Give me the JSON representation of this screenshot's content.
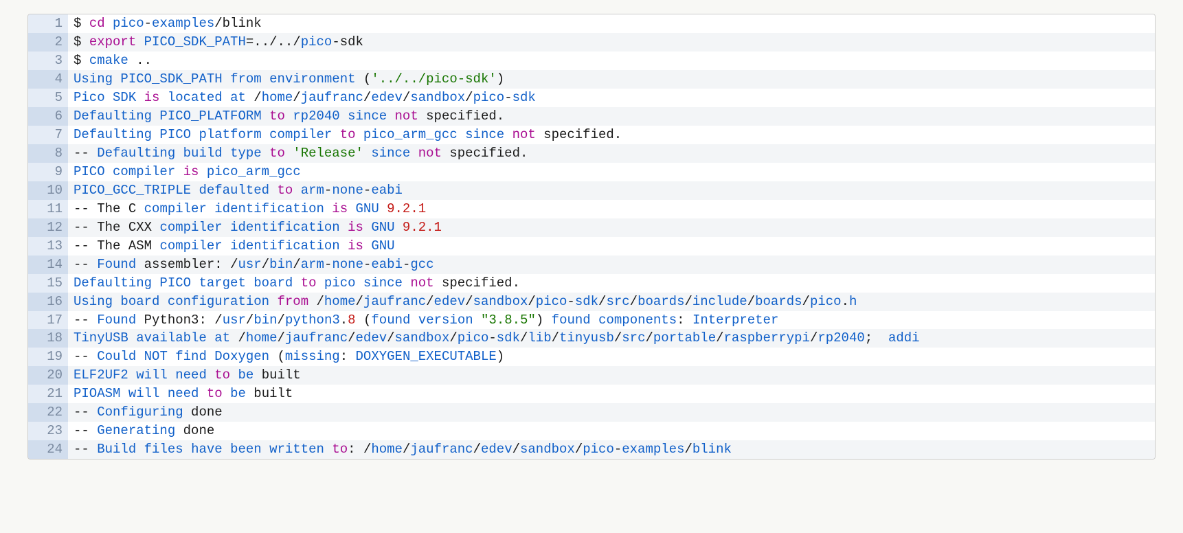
{
  "lines": [
    {
      "n": 1,
      "tokens": [
        [
          "$ ",
          "t-black"
        ],
        [
          "cd ",
          "t-purple"
        ],
        [
          "pico",
          "t-blue"
        ],
        [
          "-",
          "t-black"
        ],
        [
          "examples",
          "t-blue"
        ],
        [
          "/",
          "t-black"
        ],
        [
          "blink",
          "t-black"
        ]
      ]
    },
    {
      "n": 2,
      "tokens": [
        [
          "$ ",
          "t-black"
        ],
        [
          "export ",
          "t-purple"
        ],
        [
          "PICO_SDK_PATH",
          "t-blue"
        ],
        [
          "=",
          "t-black"
        ],
        [
          ".",
          "t-black"
        ],
        [
          ".",
          "t-black"
        ],
        [
          "/",
          "t-black"
        ],
        [
          ".",
          "t-black"
        ],
        [
          ".",
          "t-black"
        ],
        [
          "/",
          "t-black"
        ],
        [
          "pico",
          "t-blue"
        ],
        [
          "-",
          "t-black"
        ],
        [
          "sdk",
          "t-black"
        ]
      ]
    },
    {
      "n": 3,
      "tokens": [
        [
          "$ ",
          "t-black"
        ],
        [
          "cmake ",
          "t-blue"
        ],
        [
          "..",
          "t-black"
        ]
      ]
    },
    {
      "n": 4,
      "tokens": [
        [
          "Using ",
          "t-blue"
        ],
        [
          "PICO_SDK_PATH ",
          "t-blue"
        ],
        [
          "from ",
          "t-blue"
        ],
        [
          "environment ",
          "t-blue"
        ],
        [
          "(",
          "t-black"
        ],
        [
          "'../../pico-sdk'",
          "t-green"
        ],
        [
          ")",
          "t-black"
        ]
      ]
    },
    {
      "n": 5,
      "tokens": [
        [
          "Pico ",
          "t-blue"
        ],
        [
          "SDK ",
          "t-blue"
        ],
        [
          "is ",
          "t-purple"
        ],
        [
          "located ",
          "t-blue"
        ],
        [
          "at ",
          "t-blue"
        ],
        [
          "/",
          "t-black"
        ],
        [
          "home",
          "t-blue"
        ],
        [
          "/",
          "t-black"
        ],
        [
          "jaufranc",
          "t-blue"
        ],
        [
          "/",
          "t-black"
        ],
        [
          "edev",
          "t-blue"
        ],
        [
          "/",
          "t-black"
        ],
        [
          "sandbox",
          "t-blue"
        ],
        [
          "/",
          "t-black"
        ],
        [
          "pico",
          "t-blue"
        ],
        [
          "-",
          "t-black"
        ],
        [
          "sdk",
          "t-blue"
        ]
      ]
    },
    {
      "n": 6,
      "tokens": [
        [
          "Defaulting ",
          "t-blue"
        ],
        [
          "PICO_PLATFORM ",
          "t-blue"
        ],
        [
          "to ",
          "t-purple"
        ],
        [
          "rp2040 ",
          "t-blue"
        ],
        [
          "since ",
          "t-blue"
        ],
        [
          "not ",
          "t-purple"
        ],
        [
          "specified",
          "t-black"
        ],
        [
          ".",
          "t-black"
        ]
      ]
    },
    {
      "n": 7,
      "tokens": [
        [
          "Defaulting ",
          "t-blue"
        ],
        [
          "PICO ",
          "t-blue"
        ],
        [
          "platform ",
          "t-blue"
        ],
        [
          "compiler ",
          "t-blue"
        ],
        [
          "to ",
          "t-purple"
        ],
        [
          "pico_arm_gcc ",
          "t-blue"
        ],
        [
          "since ",
          "t-blue"
        ],
        [
          "not ",
          "t-purple"
        ],
        [
          "specified",
          "t-black"
        ],
        [
          ".",
          "t-black"
        ]
      ]
    },
    {
      "n": 8,
      "tokens": [
        [
          "-- ",
          "t-black"
        ],
        [
          "Defaulting ",
          "t-blue"
        ],
        [
          "build ",
          "t-blue"
        ],
        [
          "type ",
          "t-blue"
        ],
        [
          "to ",
          "t-purple"
        ],
        [
          "'Release' ",
          "t-green"
        ],
        [
          "since ",
          "t-blue"
        ],
        [
          "not ",
          "t-purple"
        ],
        [
          "specified",
          "t-black"
        ],
        [
          ".",
          "t-black"
        ]
      ]
    },
    {
      "n": 9,
      "tokens": [
        [
          "PICO ",
          "t-blue"
        ],
        [
          "compiler ",
          "t-blue"
        ],
        [
          "is ",
          "t-purple"
        ],
        [
          "pico_arm_gcc",
          "t-blue"
        ]
      ]
    },
    {
      "n": 10,
      "tokens": [
        [
          "PICO_GCC_TRIPLE ",
          "t-blue"
        ],
        [
          "defaulted ",
          "t-blue"
        ],
        [
          "to ",
          "t-purple"
        ],
        [
          "arm",
          "t-blue"
        ],
        [
          "-",
          "t-black"
        ],
        [
          "none",
          "t-blue"
        ],
        [
          "-",
          "t-black"
        ],
        [
          "eabi",
          "t-blue"
        ]
      ]
    },
    {
      "n": 11,
      "tokens": [
        [
          "-- ",
          "t-black"
        ],
        [
          "The ",
          "t-black"
        ],
        [
          "C ",
          "t-black"
        ],
        [
          "compiler ",
          "t-blue"
        ],
        [
          "identification ",
          "t-blue"
        ],
        [
          "is ",
          "t-purple"
        ],
        [
          "GNU ",
          "t-blue"
        ],
        [
          "9.2.1",
          "t-red"
        ]
      ]
    },
    {
      "n": 12,
      "tokens": [
        [
          "-- ",
          "t-black"
        ],
        [
          "The ",
          "t-black"
        ],
        [
          "CXX ",
          "t-black"
        ],
        [
          "compiler ",
          "t-blue"
        ],
        [
          "identification ",
          "t-blue"
        ],
        [
          "is ",
          "t-purple"
        ],
        [
          "GNU ",
          "t-blue"
        ],
        [
          "9.2.1",
          "t-red"
        ]
      ]
    },
    {
      "n": 13,
      "tokens": [
        [
          "-- ",
          "t-black"
        ],
        [
          "The ",
          "t-black"
        ],
        [
          "ASM ",
          "t-black"
        ],
        [
          "compiler ",
          "t-blue"
        ],
        [
          "identification ",
          "t-blue"
        ],
        [
          "is ",
          "t-purple"
        ],
        [
          "GNU",
          "t-blue"
        ]
      ]
    },
    {
      "n": 14,
      "tokens": [
        [
          "-- ",
          "t-black"
        ],
        [
          "Found ",
          "t-blue"
        ],
        [
          "assembler",
          "t-black"
        ],
        [
          ": ",
          "t-black"
        ],
        [
          "/",
          "t-black"
        ],
        [
          "usr",
          "t-blue"
        ],
        [
          "/",
          "t-black"
        ],
        [
          "bin",
          "t-blue"
        ],
        [
          "/",
          "t-black"
        ],
        [
          "arm",
          "t-blue"
        ],
        [
          "-",
          "t-black"
        ],
        [
          "none",
          "t-blue"
        ],
        [
          "-",
          "t-black"
        ],
        [
          "eabi",
          "t-blue"
        ],
        [
          "-",
          "t-black"
        ],
        [
          "gcc",
          "t-blue"
        ]
      ]
    },
    {
      "n": 15,
      "tokens": [
        [
          "Defaulting ",
          "t-blue"
        ],
        [
          "PICO ",
          "t-blue"
        ],
        [
          "target ",
          "t-blue"
        ],
        [
          "board ",
          "t-blue"
        ],
        [
          "to ",
          "t-purple"
        ],
        [
          "pico ",
          "t-blue"
        ],
        [
          "since ",
          "t-blue"
        ],
        [
          "not ",
          "t-purple"
        ],
        [
          "specified",
          "t-black"
        ],
        [
          ".",
          "t-black"
        ]
      ]
    },
    {
      "n": 16,
      "tokens": [
        [
          "Using ",
          "t-blue"
        ],
        [
          "board ",
          "t-blue"
        ],
        [
          "configuration ",
          "t-blue"
        ],
        [
          "from ",
          "t-purple"
        ],
        [
          "/",
          "t-black"
        ],
        [
          "home",
          "t-blue"
        ],
        [
          "/",
          "t-black"
        ],
        [
          "jaufranc",
          "t-blue"
        ],
        [
          "/",
          "t-black"
        ],
        [
          "edev",
          "t-blue"
        ],
        [
          "/",
          "t-black"
        ],
        [
          "sandbox",
          "t-blue"
        ],
        [
          "/",
          "t-black"
        ],
        [
          "pico",
          "t-blue"
        ],
        [
          "-",
          "t-black"
        ],
        [
          "sdk",
          "t-blue"
        ],
        [
          "/",
          "t-black"
        ],
        [
          "src",
          "t-blue"
        ],
        [
          "/",
          "t-black"
        ],
        [
          "boards",
          "t-blue"
        ],
        [
          "/",
          "t-black"
        ],
        [
          "include",
          "t-blue"
        ],
        [
          "/",
          "t-black"
        ],
        [
          "boards",
          "t-blue"
        ],
        [
          "/",
          "t-black"
        ],
        [
          "pico",
          "t-blue"
        ],
        [
          ".",
          "t-black"
        ],
        [
          "h",
          "t-blue"
        ]
      ]
    },
    {
      "n": 17,
      "tokens": [
        [
          "-- ",
          "t-black"
        ],
        [
          "Found ",
          "t-blue"
        ],
        [
          "Python3",
          "t-black"
        ],
        [
          ": ",
          "t-black"
        ],
        [
          "/",
          "t-black"
        ],
        [
          "usr",
          "t-blue"
        ],
        [
          "/",
          "t-black"
        ],
        [
          "bin",
          "t-blue"
        ],
        [
          "/",
          "t-black"
        ],
        [
          "python3",
          "t-blue"
        ],
        [
          ".",
          "t-black"
        ],
        [
          "8 ",
          "t-red"
        ],
        [
          "(",
          "t-black"
        ],
        [
          "found ",
          "t-blue"
        ],
        [
          "version ",
          "t-blue"
        ],
        [
          "\"3.8.5\"",
          "t-green"
        ],
        [
          ") ",
          "t-black"
        ],
        [
          "found ",
          "t-blue"
        ],
        [
          "components",
          "t-blue"
        ],
        [
          ": ",
          "t-black"
        ],
        [
          "Interpreter",
          "t-blue"
        ]
      ]
    },
    {
      "n": 18,
      "tokens": [
        [
          "TinyUSB ",
          "t-blue"
        ],
        [
          "available ",
          "t-blue"
        ],
        [
          "at ",
          "t-blue"
        ],
        [
          "/",
          "t-black"
        ],
        [
          "home",
          "t-blue"
        ],
        [
          "/",
          "t-black"
        ],
        [
          "jaufranc",
          "t-blue"
        ],
        [
          "/",
          "t-black"
        ],
        [
          "edev",
          "t-blue"
        ],
        [
          "/",
          "t-black"
        ],
        [
          "sandbox",
          "t-blue"
        ],
        [
          "/",
          "t-black"
        ],
        [
          "pico",
          "t-blue"
        ],
        [
          "-",
          "t-black"
        ],
        [
          "sdk",
          "t-blue"
        ],
        [
          "/",
          "t-black"
        ],
        [
          "lib",
          "t-blue"
        ],
        [
          "/",
          "t-black"
        ],
        [
          "tinyusb",
          "t-blue"
        ],
        [
          "/",
          "t-black"
        ],
        [
          "src",
          "t-blue"
        ],
        [
          "/",
          "t-black"
        ],
        [
          "portable",
          "t-blue"
        ],
        [
          "/",
          "t-black"
        ],
        [
          "raspberrypi",
          "t-blue"
        ],
        [
          "/",
          "t-black"
        ],
        [
          "rp2040",
          "t-blue"
        ],
        [
          "; ",
          "t-black"
        ],
        [
          " addi",
          "t-blue"
        ]
      ]
    },
    {
      "n": 19,
      "tokens": [
        [
          "-- ",
          "t-black"
        ],
        [
          "Could ",
          "t-blue"
        ],
        [
          "NOT ",
          "t-blue"
        ],
        [
          "find ",
          "t-blue"
        ],
        [
          "Doxygen ",
          "t-blue"
        ],
        [
          "(",
          "t-black"
        ],
        [
          "missing",
          "t-blue"
        ],
        [
          ": ",
          "t-black"
        ],
        [
          "DOXYGEN_EXECUTABLE",
          "t-blue"
        ],
        [
          ")",
          "t-black"
        ]
      ]
    },
    {
      "n": 20,
      "tokens": [
        [
          "ELF2UF2 ",
          "t-blue"
        ],
        [
          "will ",
          "t-blue"
        ],
        [
          "need ",
          "t-blue"
        ],
        [
          "to ",
          "t-purple"
        ],
        [
          "be ",
          "t-blue"
        ],
        [
          "built",
          "t-black"
        ]
      ]
    },
    {
      "n": 21,
      "tokens": [
        [
          "PIOASM ",
          "t-blue"
        ],
        [
          "will ",
          "t-blue"
        ],
        [
          "need ",
          "t-blue"
        ],
        [
          "to ",
          "t-purple"
        ],
        [
          "be ",
          "t-blue"
        ],
        [
          "built",
          "t-black"
        ]
      ]
    },
    {
      "n": 22,
      "tokens": [
        [
          "-- ",
          "t-black"
        ],
        [
          "Configuring ",
          "t-blue"
        ],
        [
          "done",
          "t-black"
        ]
      ]
    },
    {
      "n": 23,
      "tokens": [
        [
          "-- ",
          "t-black"
        ],
        [
          "Generating ",
          "t-blue"
        ],
        [
          "done",
          "t-black"
        ]
      ]
    },
    {
      "n": 24,
      "tokens": [
        [
          "-- ",
          "t-black"
        ],
        [
          "Build ",
          "t-blue"
        ],
        [
          "files ",
          "t-blue"
        ],
        [
          "have ",
          "t-blue"
        ],
        [
          "been ",
          "t-blue"
        ],
        [
          "written ",
          "t-blue"
        ],
        [
          "to",
          "t-purple"
        ],
        [
          ": ",
          "t-black"
        ],
        [
          "/",
          "t-black"
        ],
        [
          "home",
          "t-blue"
        ],
        [
          "/",
          "t-black"
        ],
        [
          "jaufranc",
          "t-blue"
        ],
        [
          "/",
          "t-black"
        ],
        [
          "edev",
          "t-blue"
        ],
        [
          "/",
          "t-black"
        ],
        [
          "sandbox",
          "t-blue"
        ],
        [
          "/",
          "t-black"
        ],
        [
          "pico",
          "t-blue"
        ],
        [
          "-",
          "t-black"
        ],
        [
          "examples",
          "t-blue"
        ],
        [
          "/",
          "t-black"
        ],
        [
          "blink",
          "t-blue"
        ]
      ]
    }
  ]
}
